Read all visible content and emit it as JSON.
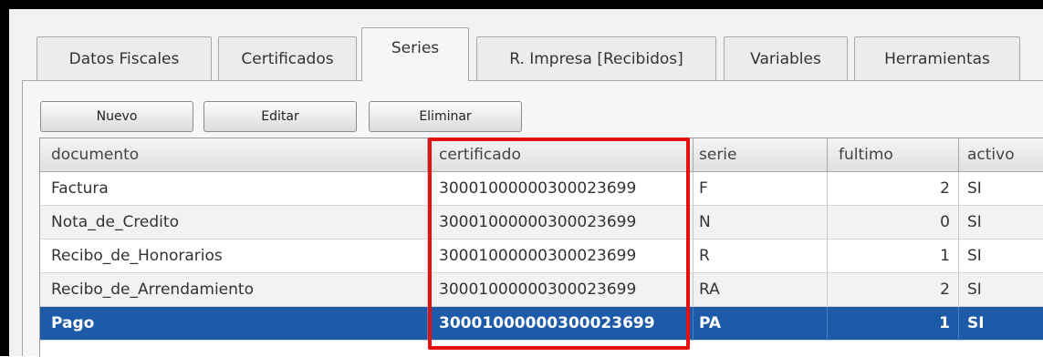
{
  "tabs": [
    {
      "label": "Datos Fiscales"
    },
    {
      "label": "Certificados"
    },
    {
      "label": "Series"
    },
    {
      "label": "R. Impresa [Recibidos]"
    },
    {
      "label": "Variables"
    },
    {
      "label": "Herramientas"
    }
  ],
  "active_tab": "Series",
  "toolbar": {
    "new_label": "Nuevo",
    "edit_label": "Editar",
    "delete_label": "Eliminar"
  },
  "table": {
    "columns": [
      "documento",
      "certificado",
      "serie",
      "fultimo",
      "activo"
    ],
    "rows": [
      {
        "documento": "Factura",
        "certificado": "30001000000300023699",
        "serie": "F",
        "fultimo": "2",
        "activo": "SI"
      },
      {
        "documento": "Nota_de_Credito",
        "certificado": "30001000000300023699",
        "serie": "N",
        "fultimo": "0",
        "activo": "SI"
      },
      {
        "documento": "Recibo_de_Honorarios",
        "certificado": "30001000000300023699",
        "serie": "R",
        "fultimo": "1",
        "activo": "SI"
      },
      {
        "documento": "Recibo_de_Arrendamiento",
        "certificado": "30001000000300023699",
        "serie": "RA",
        "fultimo": "2",
        "activo": "SI"
      },
      {
        "documento": "Pago",
        "certificado": "30001000000300023699",
        "serie": "PA",
        "fultimo": "1",
        "activo": "SI"
      }
    ],
    "selected_row": "Pago"
  },
  "colors": {
    "selection": "#1d5ba8",
    "annotation_highlight": "#e41111"
  }
}
